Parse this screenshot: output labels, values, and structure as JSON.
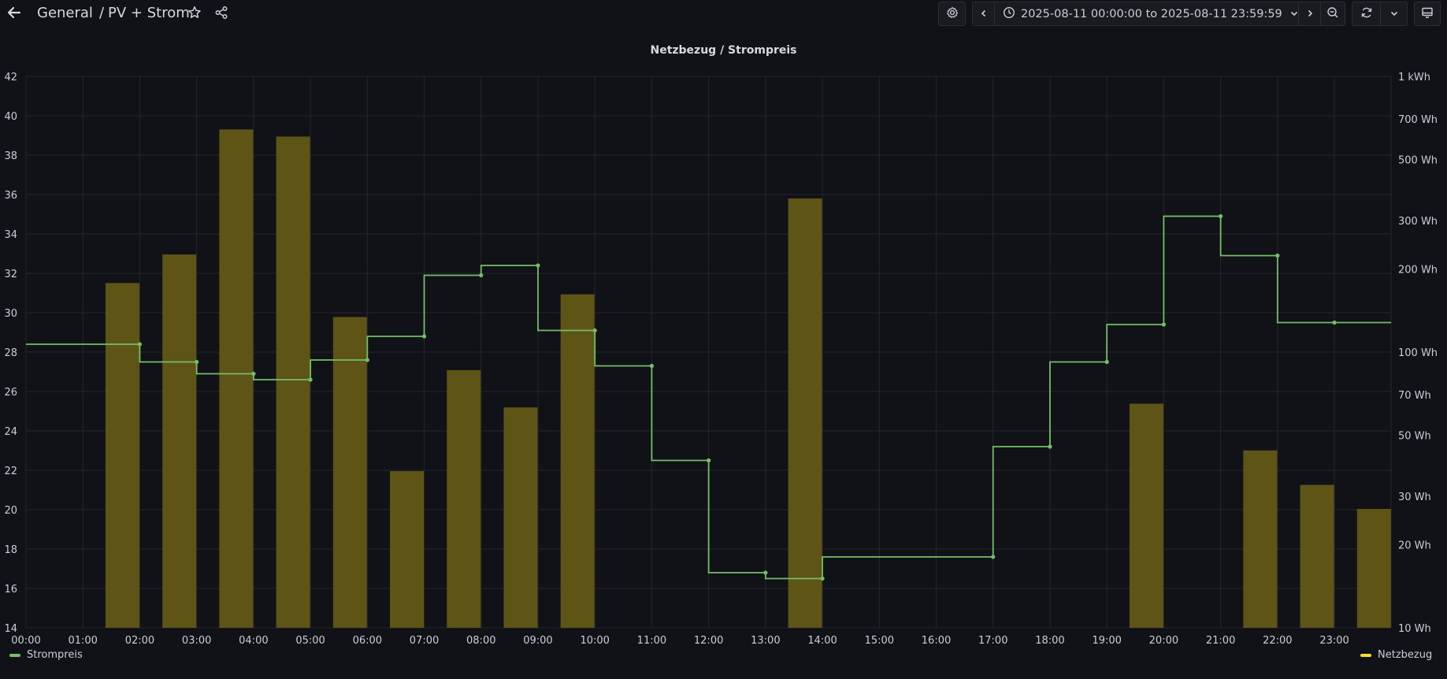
{
  "header": {
    "folder": "General",
    "separator": "/",
    "dashboard": "PV + Strom",
    "time_range": "2025-08-11 00:00:00 to 2025-08-11 23:59:59"
  },
  "panel": {
    "title": "Netzbezug / Strompreis"
  },
  "colors": {
    "background": "#111217",
    "grid": "#25272e",
    "bar_fill": "#5e5416",
    "line": "#73bf69",
    "legend_netzbezug": "#fade2a"
  },
  "icons": [
    "back-arrow-icon",
    "star-icon",
    "share-icon",
    "gear-icon",
    "chevron-left-icon",
    "clock-icon",
    "chevron-down-icon",
    "chevron-right-icon",
    "zoom-out-icon",
    "refresh-icon",
    "monitor-icon"
  ],
  "chart_data": {
    "type": "bar",
    "title": "Netzbezug / Strompreis",
    "x_ticks": [
      "00:00",
      "01:00",
      "02:00",
      "03:00",
      "04:00",
      "05:00",
      "06:00",
      "07:00",
      "08:00",
      "09:00",
      "10:00",
      "11:00",
      "12:00",
      "13:00",
      "14:00",
      "15:00",
      "16:00",
      "17:00",
      "18:00",
      "19:00",
      "20:00",
      "21:00",
      "22:00",
      "23:00"
    ],
    "y_left_ticks": [
      "14",
      "16",
      "18",
      "20",
      "22",
      "24",
      "26",
      "28",
      "30",
      "32",
      "34",
      "36",
      "38",
      "40",
      "42"
    ],
    "y_left_range": [
      14,
      42
    ],
    "y_right_ticks": [
      "10 Wh",
      "20 Wh",
      "30 Wh",
      "50 Wh",
      "70 Wh",
      "100 Wh",
      "200 Wh",
      "300 Wh",
      "500 Wh",
      "700 Wh",
      "1 kWh"
    ],
    "y_right_values": [
      10,
      20,
      30,
      50,
      70,
      100,
      200,
      300,
      500,
      700,
      1000
    ],
    "y_right_scale": "log",
    "y_right_range": [
      10,
      1000
    ],
    "grid": true,
    "series": [
      {
        "name": "Strompreis",
        "type": "line",
        "axis": "left",
        "step": "after",
        "x_hours": [
          0,
          2,
          3,
          4,
          5,
          6,
          7,
          8,
          9,
          10,
          11,
          12,
          13,
          14,
          17,
          18,
          19,
          20,
          21,
          22,
          23
        ],
        "values": [
          28.4,
          27.5,
          26.9,
          26.6,
          27.6,
          28.8,
          31.9,
          32.4,
          29.1,
          27.3,
          22.5,
          16.8,
          16.5,
          17.6,
          23.2,
          27.5,
          29.4,
          34.9,
          32.9,
          29.5,
          29.5
        ]
      },
      {
        "name": "Netzbezug",
        "type": "bar",
        "axis": "right",
        "hours": [
          2,
          3,
          4,
          5,
          6,
          7,
          8,
          9,
          10,
          14,
          20,
          22,
          23,
          24
        ],
        "values": [
          178,
          226,
          642,
          605,
          134,
          37,
          86,
          63,
          162,
          361,
          65,
          44,
          33,
          27
        ]
      }
    ]
  }
}
